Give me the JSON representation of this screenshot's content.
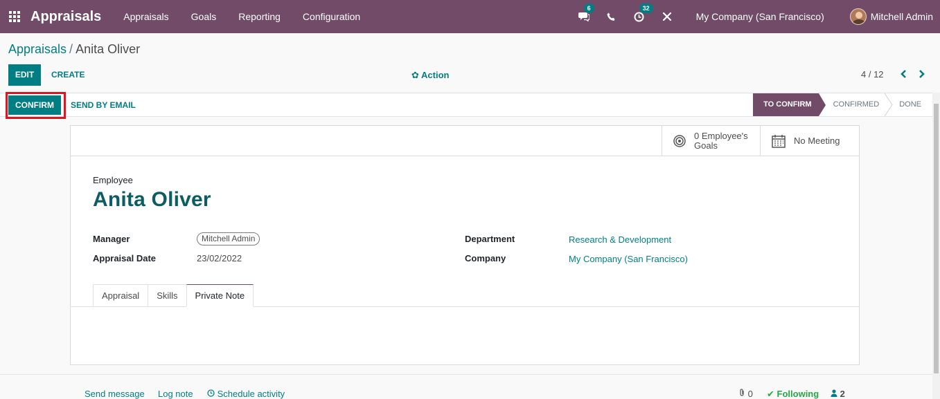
{
  "navbar": {
    "app_name": "Appraisals",
    "menu": [
      "Appraisals",
      "Goals",
      "Reporting",
      "Configuration"
    ],
    "messages_badge": "6",
    "activities_badge": "32",
    "company": "My Company (San Francisco)",
    "user": "Mitchell Admin"
  },
  "breadcrumb": {
    "parent": "Appraisals",
    "separator": "/",
    "current": "Anita Oliver"
  },
  "control": {
    "edit": "EDIT",
    "create": "CREATE",
    "action": "Action",
    "pager": "4 / 12"
  },
  "statusbar": {
    "confirm": "CONFIRM",
    "send_email": "SEND BY EMAIL",
    "stages": [
      "TO CONFIRM",
      "CONFIRMED",
      "DONE"
    ],
    "active_stage": "TO CONFIRM"
  },
  "smart_buttons": {
    "goals_line1": "0 Employee's",
    "goals_line2": "Goals",
    "meeting": "No Meeting"
  },
  "form": {
    "employee_label": "Employee",
    "employee_name": "Anita Oliver",
    "manager_label": "Manager",
    "manager_value": "Mitchell Admin",
    "date_label": "Appraisal Date",
    "date_value": "23/02/2022",
    "department_label": "Department",
    "department_value": "Research & Development",
    "company_label": "Company",
    "company_value": "My Company (San Francisco)"
  },
  "tabs": [
    "Appraisal",
    "Skills",
    "Private Note"
  ],
  "active_tab": "Private Note",
  "chatter": {
    "send_message": "Send message",
    "log_note": "Log note",
    "schedule": "Schedule activity",
    "attachments": "0",
    "following": "Following",
    "followers": "2"
  },
  "colors": {
    "brand": "#714b67",
    "primary": "#017e84",
    "highlight": "#e0141e"
  }
}
